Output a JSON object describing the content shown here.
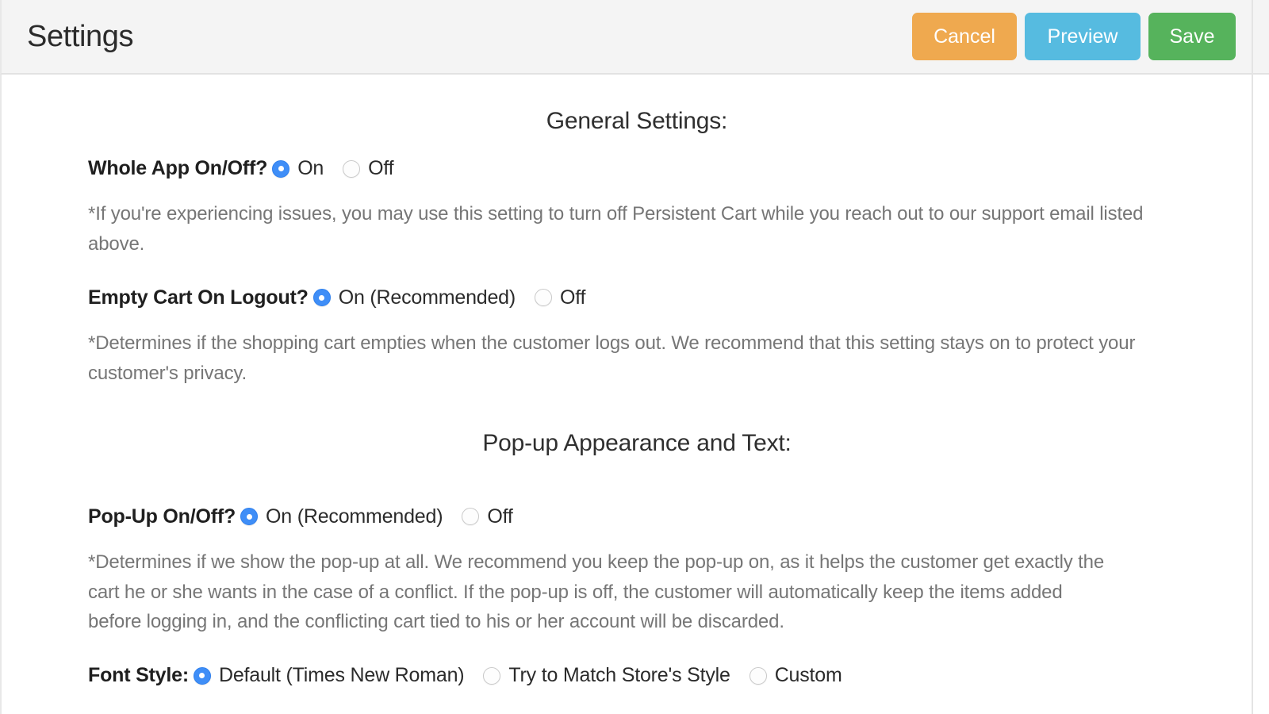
{
  "header": {
    "title": "Settings",
    "buttons": [
      {
        "label": "Cancel",
        "color": "#efa94f"
      },
      {
        "label": "Preview",
        "color": "#56bbe0"
      },
      {
        "label": "Save",
        "color": "#56b35c"
      }
    ]
  },
  "sections": {
    "general": {
      "heading": "General Settings:",
      "whole_app": {
        "label": "Whole App On/Off?",
        "options": [
          {
            "label": "On",
            "selected": true
          },
          {
            "label": "Off",
            "selected": false
          }
        ],
        "help": "*If you're experiencing issues, you may use this setting to turn off Persistent Cart while you reach out to our support email listed above."
      },
      "empty_cart": {
        "label": "Empty Cart On Logout?",
        "options": [
          {
            "label": "On (Recommended)",
            "selected": true
          },
          {
            "label": "Off",
            "selected": false
          }
        ],
        "help": "*Determines if the shopping cart empties when the customer logs out. We recommend that this setting stays on to protect your customer's privacy."
      }
    },
    "popup": {
      "heading": "Pop-up Appearance and Text:",
      "popup_onoff": {
        "label": "Pop-Up On/Off?",
        "options": [
          {
            "label": "On (Recommended)",
            "selected": true
          },
          {
            "label": "Off",
            "selected": false
          }
        ],
        "help": "*Determines if we show the pop-up at all. We recommend you keep the pop-up on, as it helps the customer get exactly the cart he or she wants in the case of a conflict. If the pop-up is off, the customer will automatically keep the items added before logging in, and the conflicting cart tied to his or her account will be discarded."
      },
      "font_style": {
        "label": "Font Style:",
        "options": [
          {
            "label": "Default (Times New Roman)",
            "selected": true
          },
          {
            "label": "Try to Match Store's Style",
            "selected": false
          },
          {
            "label": "Custom",
            "selected": false
          }
        ]
      }
    }
  },
  "colors": {
    "radio_selected": "#3f8ef7",
    "header_bg": "#f4f4f4",
    "help_text": "#767676"
  }
}
